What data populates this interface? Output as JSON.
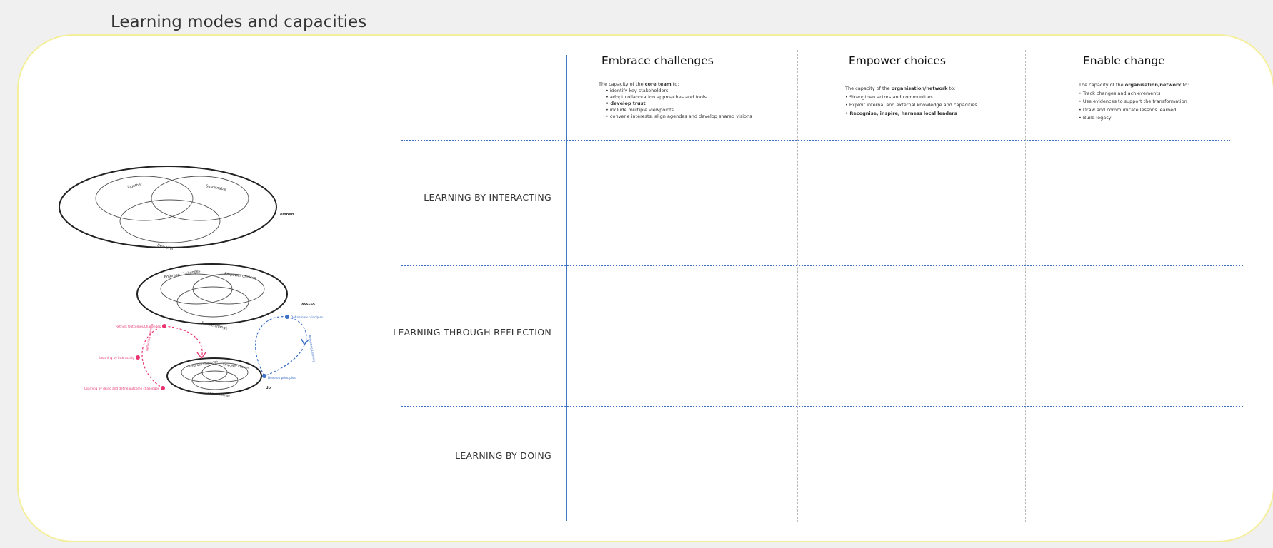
{
  "board": {
    "title": "Learning modes and capacities"
  },
  "columns": [
    {
      "header": "Embrace challenges",
      "intro_pre": "The capacity of the ",
      "intro_bold": "core team",
      "intro_post": " to:",
      "items": [
        "identify key stakeholders",
        "adopt collaboration approaches and tools",
        "develop trust",
        "include multiple viewpoints",
        "convene interests, align agendas and develop shared visions"
      ]
    },
    {
      "header": "Empower choices",
      "intro_pre": "The capacity of the ",
      "intro_bold": "organisation/network",
      "intro_post": " to:",
      "items": [
        "Strengthen actors and communities",
        "Exploit internal and external knowledge and capacities",
        "Recognise, inspire, harness local leaders"
      ]
    },
    {
      "header": "Enable change",
      "intro_pre": "The capacity of the ",
      "intro_bold": "organisation/network",
      "intro_post": " to:",
      "items": [
        "Track changes and achievements",
        "Use evidences to support the transformation",
        "Draw and communicate lessons learned",
        "Build legacy"
      ]
    }
  ],
  "rows": [
    {
      "label": "LEARNING BY INTERACTING"
    },
    {
      "label": "LEARNING THROUGH REFLECTION"
    },
    {
      "label": "LEARNING BY DOING"
    }
  ],
  "diagram": {
    "top": {
      "outer": "embed",
      "labels": [
        "Together",
        "Sustainable",
        "Beautiful"
      ]
    },
    "middle": {
      "outer": "ASSESS",
      "labels": [
        "Embrace Challenges",
        "Empower Choices",
        "Enable change"
      ]
    },
    "bottom": {
      "outer": "do",
      "labels": [
        "Embrace Challenge",
        "Empower Choices",
        "Enable change"
      ]
    },
    "left_labels": [
      "Rethink Outcomes/Challenges",
      "Learning by Interacting",
      "Learning by doing and define outcome challenges"
    ],
    "right_labels": [
      "Define new principles",
      "Develop principles"
    ],
    "arc_labels": [
      "Reflecting Learning",
      "Reflecting Learning"
    ],
    "colors": {
      "pink": "#e8336e",
      "blue": "#3d6fc9"
    }
  }
}
